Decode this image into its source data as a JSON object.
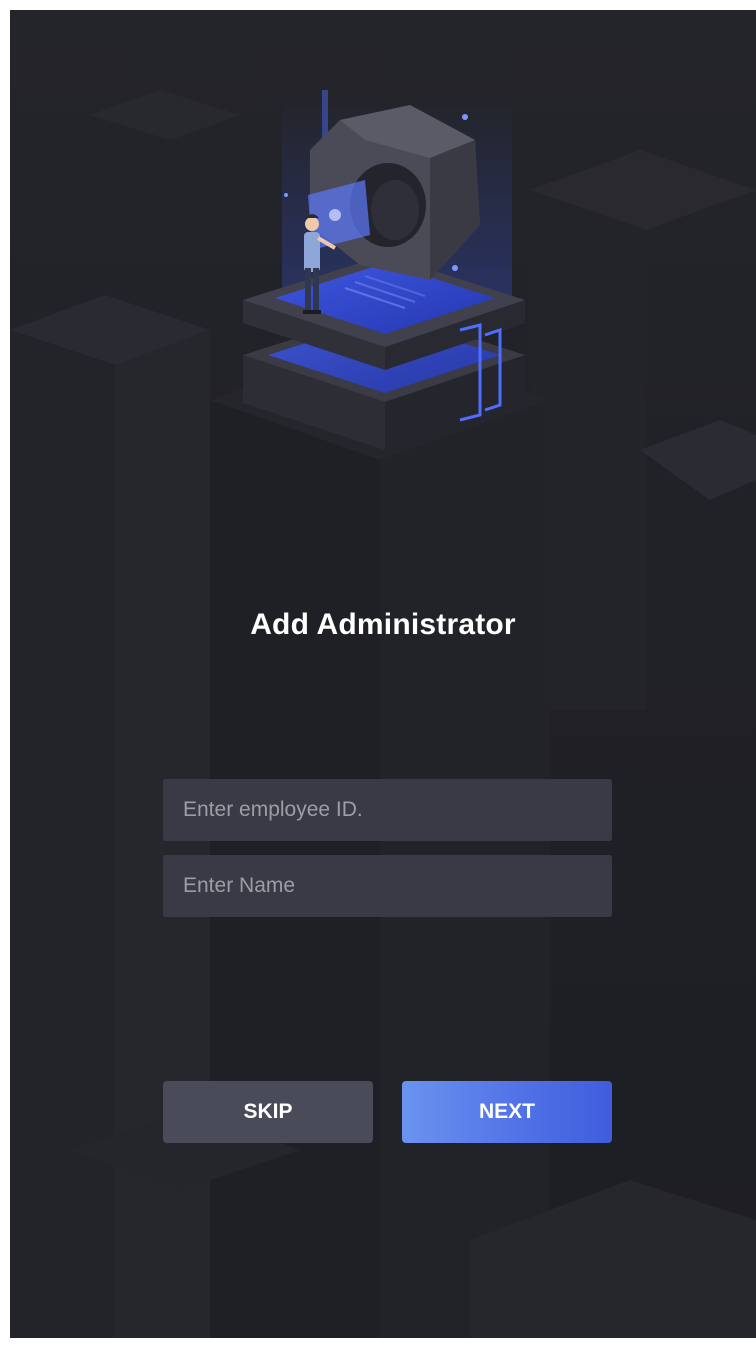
{
  "page": {
    "title": "Add Administrator"
  },
  "form": {
    "employee_id": {
      "placeholder": "Enter employee ID.",
      "value": ""
    },
    "name": {
      "placeholder": "Enter Name",
      "value": ""
    }
  },
  "actions": {
    "skip_label": "SKIP",
    "next_label": "NEXT"
  },
  "colors": {
    "background": "#202127",
    "field": "#393a45",
    "skip_button": "#4a4b58",
    "next_button_start": "#6b93f0",
    "next_button_end": "#3f5ddc",
    "accent": "#4a63e8"
  },
  "icons": {
    "hero": "admin-setup-illustration"
  }
}
